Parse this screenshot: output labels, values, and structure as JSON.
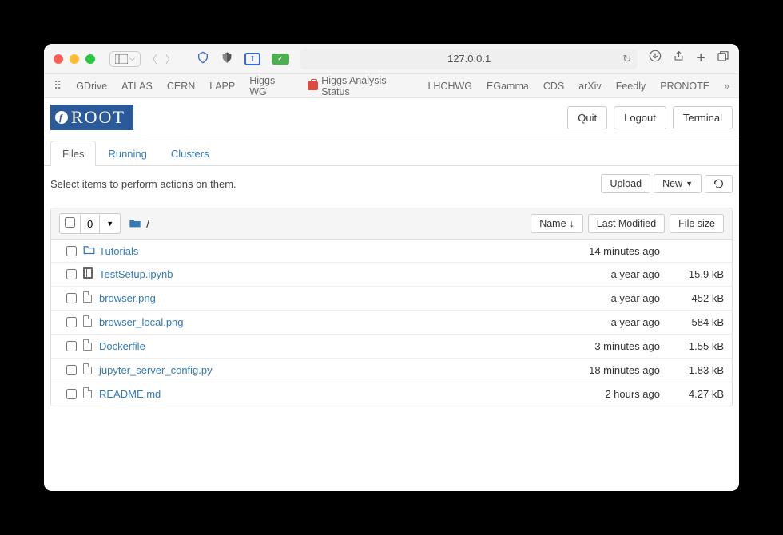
{
  "url": "127.0.0.1",
  "bookmarks": [
    "GDrive",
    "ATLAS",
    "CERN",
    "LAPP",
    "Higgs WG",
    "Higgs Analysis Status",
    "LHCHWG",
    "EGamma",
    "CDS",
    "arXiv",
    "Feedly",
    "PRONOTE"
  ],
  "logo_text": "ROOT",
  "header_buttons": {
    "quit": "Quit",
    "logout": "Logout",
    "terminal": "Terminal"
  },
  "tabs": {
    "files": "Files",
    "running": "Running",
    "clusters": "Clusters"
  },
  "hint": "Select items to perform actions on them.",
  "controls": {
    "upload": "Upload",
    "new": "New",
    "selected_count": "0",
    "breadcrumb": "/"
  },
  "columns": {
    "name": "Name",
    "modified": "Last Modified",
    "size": "File size"
  },
  "files": [
    {
      "name": "Tutorials",
      "type": "folder",
      "modified": "14 minutes ago",
      "size": ""
    },
    {
      "name": "TestSetup.ipynb",
      "type": "notebook",
      "modified": "a year ago",
      "size": "15.9 kB"
    },
    {
      "name": "browser.png",
      "type": "file",
      "modified": "a year ago",
      "size": "452 kB"
    },
    {
      "name": "browser_local.png",
      "type": "file",
      "modified": "a year ago",
      "size": "584 kB"
    },
    {
      "name": "Dockerfile",
      "type": "file",
      "modified": "3 minutes ago",
      "size": "1.55 kB"
    },
    {
      "name": "jupyter_server_config.py",
      "type": "file",
      "modified": "18 minutes ago",
      "size": "1.83 kB"
    },
    {
      "name": "README.md",
      "type": "file",
      "modified": "2 hours ago",
      "size": "4.27 kB"
    }
  ]
}
